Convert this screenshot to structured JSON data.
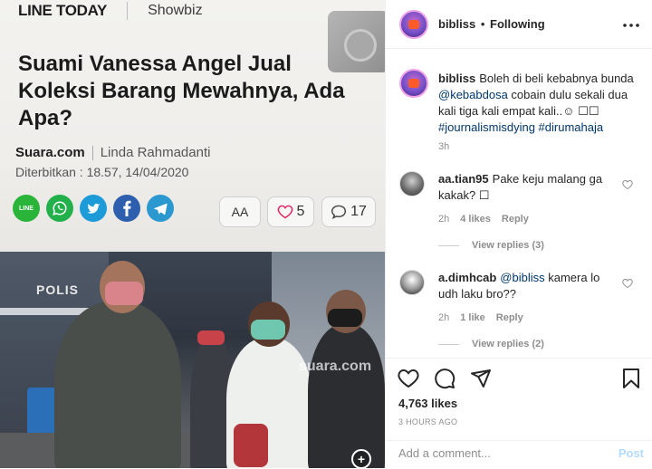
{
  "article": {
    "brand": "LINE TODAY",
    "section": "Showbiz",
    "headline": "Suami Vanessa Angel Jual Koleksi Barang Mewahnya, Ada Apa?",
    "source": "Suara.com",
    "author": "Linda Rahmadanti",
    "published": "Diterbitkan : 18.57, 14/04/2020",
    "share_icons": [
      "line-icon",
      "whatsapp-icon",
      "twitter-icon",
      "facebook-icon",
      "telegram-icon"
    ],
    "line_label": "LINE",
    "font_size_label": "AA",
    "like_count": "5",
    "comment_count": "17",
    "truck_label": "POLIS",
    "watermark": "suara.com"
  },
  "header": {
    "username": "bibliss",
    "dot": "•",
    "follow_state": "Following",
    "more_icon": "more-horizontal-icon"
  },
  "caption": {
    "username": "bibliss",
    "text_before": "Boleh di beli kebabnya bunda ",
    "mention": "@kebabdosa",
    "text_after": " cobain dulu sekali dua kali tiga kali empat kali..",
    "emoji": "☺ ☐☐",
    "tags": "#journalismisdying #dirumahaja",
    "time": "3h"
  },
  "comments": [
    {
      "username": "aa.tian95",
      "text": "Pake keju malang ga kakak? ☐",
      "time": "2h",
      "likes": "4 likes",
      "reply_label": "Reply",
      "view_replies": "View replies (3)"
    },
    {
      "username": "a.dimhcab",
      "mention": "@bibliss",
      "text": " kamera lo udh laku bro??",
      "time": "2h",
      "likes": "1 like",
      "reply_label": "Reply",
      "view_replies": "View replies (2)"
    }
  ],
  "actions": {
    "icons": [
      "heart-icon",
      "comment-icon",
      "share-icon",
      "bookmark-icon"
    ],
    "likes": "4,763 likes",
    "time_ago": "3 HOURS AGO",
    "add_comment_placeholder": "Add a comment...",
    "post_label": "Post"
  },
  "colors": {
    "link": "#00376b",
    "muted": "#8e8e8e",
    "post_disabled": "#b3dbff",
    "accent_heart": "#e0245e"
  }
}
